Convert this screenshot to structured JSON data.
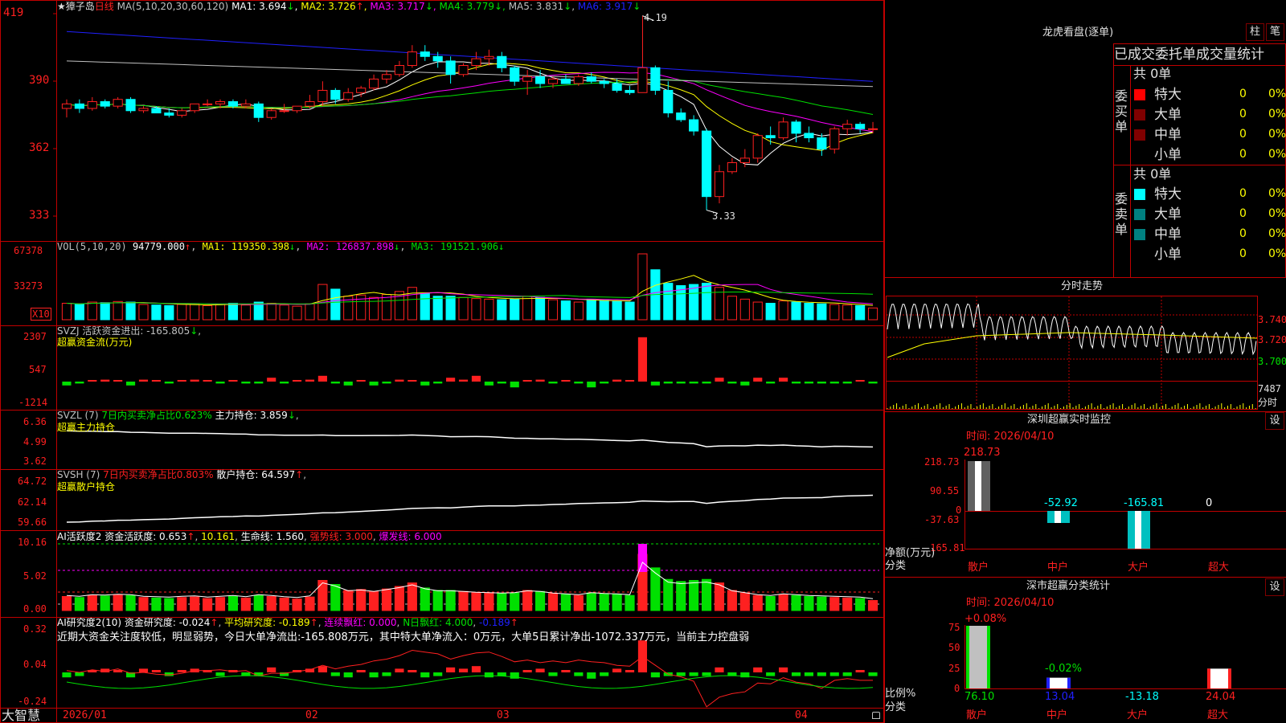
{
  "colors": {
    "up": "#ff2020",
    "down": "#00ffff",
    "green": "#00e000",
    "frame": "#c00000",
    "text": "#c0c0c0",
    "yellow": "#ffff00",
    "magenta": "#ff00ff",
    "blue": "#2020ff",
    "white": "#ffffff"
  },
  "stock": {
    "name": "★獐子岛",
    "period": "日线",
    "ma_label": "MA(5,10,20,30,60,120)",
    "ma": [
      {
        "label": "MA1:",
        "value": "3.694",
        "arrow": "↓"
      },
      {
        "label": "MA2:",
        "value": "3.726",
        "arrow": "↑"
      },
      {
        "label": "MA3:",
        "value": "3.717",
        "arrow": "↓"
      },
      {
        "label": "MA4:",
        "value": "3.779",
        "arrow": "↓"
      },
      {
        "label": "MA5:",
        "value": "3.831",
        "arrow": "↓"
      },
      {
        "label": "MA6:",
        "value": "3.917",
        "arrow": "↓"
      }
    ],
    "high_mark": "4.19",
    "low_mark": "3.33"
  },
  "price_axis": [
    "419",
    "390",
    "362",
    "333"
  ],
  "vol": {
    "header": "VOL(5,10,20)",
    "value": "94779.000",
    "arrow": "↑",
    "ma1": "MA1: 119350.398",
    "ma1_arrow": "↓",
    "ma2": "MA2: 126837.898",
    "ma2_arrow": "↓",
    "ma3": "MA3: 191521.906",
    "ma3_arrow": "↓",
    "axis": [
      "67378",
      "33273"
    ],
    "unit": "X10"
  },
  "svzj": {
    "header": "SVZJ  活跃资金进出: -165.805",
    "arrow": "↓",
    "comma": ",",
    "sub": "超赢资金流(万元)",
    "axis": [
      "2307",
      "547",
      "-1214"
    ]
  },
  "svzl": {
    "header": "SVZL (7)",
    "mid": "7日内买卖净占比0.623%",
    "tail": "主力持仓: 3.859",
    "arrow": "↓",
    "comma": ",",
    "sub": "超赢主力持仓",
    "axis": [
      "6.36",
      "4.99",
      "3.62"
    ]
  },
  "svsh": {
    "header": "SVSH (7)",
    "mid": "7日内买卖净占比0.803%",
    "tail": "散户持仓: 64.597",
    "arrow": "↑",
    "comma": ",",
    "sub": "超赢散户持仓",
    "axis": [
      "64.72",
      "62.14",
      "59.66"
    ]
  },
  "ai2": {
    "header": "AI活跃度2 资金活跃度: 0.653",
    "arrow": "↑",
    "v2": "10.161",
    "life": "生命线: 1.560",
    "strong": "强势线: 3.000",
    "burst": "爆发线: 6.000",
    "axis": [
      "10.16",
      "5.02",
      "0.00"
    ]
  },
  "ai3": {
    "header": "AI研究度2(10) 资金研究度: -0.024",
    "arrow": "↑",
    "avg": "平均研究度: -0.189",
    "avg_arrow": "↑",
    "cont": "连续飘红: 0.000",
    "nday": "N日飘红: 4.000",
    "last": "-0.189",
    "last_arrow": "↑",
    "comment": "近期大资金关注度较低，明显弱势，今日大单净流出:-165.808万元，其中特大单净流入：0万元，大单5日累计净出-1072.337万元，当前主力控盘弱",
    "axis": [
      "0.32",
      "0.04",
      "-0.24"
    ]
  },
  "xaxis": [
    "2026/01",
    "02",
    "03",
    "04"
  ],
  "footer_brand": "大智慧",
  "lhb": {
    "title": "龙虎看盘(逐单)",
    "btn1": "柱",
    "btn2": "笔",
    "subtitle": "已成交委托单成交量统计",
    "buy_total": "共 0单",
    "buy_label": "委买单",
    "buy_rows": [
      {
        "name": "特大",
        "count": "0",
        "pct": "0%"
      },
      {
        "name": "大单",
        "count": "0",
        "pct": "0%"
      },
      {
        "name": "中单",
        "count": "0",
        "pct": "0%"
      },
      {
        "name": "小单",
        "count": "0",
        "pct": "0%"
      }
    ],
    "sell_total": "共 0单",
    "sell_label": "委卖单",
    "sell_rows": [
      {
        "name": "特大",
        "count": "0",
        "pct": "0%"
      },
      {
        "name": "大单",
        "count": "0",
        "pct": "0%"
      },
      {
        "name": "中单",
        "count": "0",
        "pct": "0%"
      },
      {
        "name": "小单",
        "count": "0",
        "pct": "0%"
      }
    ]
  },
  "intraday": {
    "title": "分时走势",
    "prices": [
      "3.740",
      "3.720",
      "3.700"
    ],
    "vol": "7487",
    "vol_unit": "分时"
  },
  "monitor": {
    "title": "深圳超赢实时监控",
    "btn": "设",
    "time": "时间: 2026/04/10",
    "axis": [
      "218.73",
      "90.55",
      "0",
      "-37.63",
      "-165.81"
    ],
    "unit": "净额(万元)",
    "unit2": "分类",
    "bars": [
      {
        "cat": "散户",
        "value": 218.73,
        "label": "218.73"
      },
      {
        "cat": "中户",
        "value": -52.92,
        "label": "-52.92"
      },
      {
        "cat": "大户",
        "value": -165.81,
        "label": "-165.81"
      },
      {
        "cat": "超大",
        "value": 0,
        "label": "0"
      }
    ]
  },
  "stats": {
    "title": "深市超赢分类统计",
    "btn": "设",
    "time": "时间: 2026/04/10",
    "axis": [
      "75",
      "50",
      "25",
      "0"
    ],
    "unit": "比例%",
    "unit2": "分类",
    "bars": [
      {
        "cat": "散户",
        "value": 76.1,
        "label": "76.10",
        "chg": "+0.08%"
      },
      {
        "cat": "中户",
        "value": 13.04,
        "label": "13.04",
        "chg": "-0.02%"
      },
      {
        "cat": "大户",
        "value": -13.18,
        "label": "-13.18",
        "chg": ""
      },
      {
        "cat": "超大",
        "value": 24.04,
        "label": "24.04",
        "chg": ""
      }
    ]
  },
  "chart_data": {
    "type": "candlestick",
    "title": "★獐子岛 日线",
    "x_labels": [
      "2026/01",
      "02",
      "03",
      "04"
    ],
    "ohlc": [
      [
        3.78,
        3.82,
        3.74,
        3.8
      ],
      [
        3.8,
        3.82,
        3.76,
        3.78
      ],
      [
        3.78,
        3.83,
        3.77,
        3.81
      ],
      [
        3.81,
        3.82,
        3.78,
        3.79
      ],
      [
        3.79,
        3.83,
        3.78,
        3.82
      ],
      [
        3.82,
        3.83,
        3.76,
        3.77
      ],
      [
        3.77,
        3.79,
        3.76,
        3.78
      ],
      [
        3.78,
        3.79,
        3.76,
        3.76
      ],
      [
        3.76,
        3.78,
        3.74,
        3.75
      ],
      [
        3.75,
        3.78,
        3.74,
        3.77
      ],
      [
        3.77,
        3.8,
        3.76,
        3.8
      ],
      [
        3.8,
        3.82,
        3.79,
        3.8
      ],
      [
        3.8,
        3.82,
        3.78,
        3.81
      ],
      [
        3.81,
        3.82,
        3.78,
        3.79
      ],
      [
        3.79,
        3.82,
        3.78,
        3.8
      ],
      [
        3.8,
        3.81,
        3.72,
        3.74
      ],
      [
        3.74,
        3.78,
        3.73,
        3.77
      ],
      [
        3.77,
        3.8,
        3.76,
        3.77
      ],
      [
        3.77,
        3.79,
        3.76,
        3.79
      ],
      [
        3.79,
        3.84,
        3.78,
        3.81
      ],
      [
        3.81,
        3.9,
        3.79,
        3.86
      ],
      [
        3.86,
        3.87,
        3.8,
        3.82
      ],
      [
        3.82,
        3.87,
        3.81,
        3.85
      ],
      [
        3.85,
        3.88,
        3.83,
        3.87
      ],
      [
        3.87,
        3.93,
        3.86,
        3.91
      ],
      [
        3.91,
        3.95,
        3.89,
        3.93
      ],
      [
        3.93,
        3.99,
        3.92,
        3.97
      ],
      [
        3.97,
        4.06,
        3.96,
        4.03
      ],
      [
        4.03,
        4.06,
        3.99,
        4.01
      ],
      [
        4.01,
        4.03,
        3.96,
        3.99
      ],
      [
        3.99,
        4.01,
        3.89,
        3.93
      ],
      [
        3.93,
        3.98,
        3.92,
        3.97
      ],
      [
        3.97,
        4.03,
        3.95,
        4.0
      ],
      [
        4.0,
        4.04,
        3.97,
        4.01
      ],
      [
        4.01,
        4.03,
        3.94,
        3.96
      ],
      [
        3.96,
        3.97,
        3.88,
        3.9
      ],
      [
        3.9,
        3.95,
        3.84,
        3.92
      ],
      [
        3.92,
        3.95,
        3.87,
        3.89
      ],
      [
        3.89,
        3.92,
        3.87,
        3.91
      ],
      [
        3.91,
        3.93,
        3.89,
        3.89
      ],
      [
        3.89,
        3.93,
        3.88,
        3.92
      ],
      [
        3.92,
        3.94,
        3.89,
        3.9
      ],
      [
        3.9,
        3.91,
        3.87,
        3.89
      ],
      [
        3.89,
        3.91,
        3.85,
        3.86
      ],
      [
        3.86,
        3.88,
        3.84,
        3.85
      ],
      [
        3.85,
        4.19,
        3.85,
        3.96
      ],
      [
        3.96,
        3.97,
        3.84,
        3.86
      ],
      [
        3.86,
        3.9,
        3.74,
        3.76
      ],
      [
        3.76,
        3.78,
        3.72,
        3.73
      ],
      [
        3.73,
        3.75,
        3.66,
        3.68
      ],
      [
        3.68,
        3.69,
        3.33,
        3.39
      ],
      [
        3.39,
        3.53,
        3.36,
        3.5
      ],
      [
        3.5,
        3.56,
        3.49,
        3.54
      ],
      [
        3.54,
        3.6,
        3.52,
        3.56
      ],
      [
        3.56,
        3.67,
        3.54,
        3.66
      ],
      [
        3.66,
        3.7,
        3.62,
        3.65
      ],
      [
        3.65,
        3.74,
        3.64,
        3.72
      ],
      [
        3.72,
        3.73,
        3.63,
        3.67
      ],
      [
        3.67,
        3.7,
        3.63,
        3.65
      ],
      [
        3.65,
        3.67,
        3.57,
        3.6
      ],
      [
        3.6,
        3.7,
        3.58,
        3.69
      ],
      [
        3.69,
        3.73,
        3.66,
        3.71
      ],
      [
        3.71,
        3.72,
        3.67,
        3.69
      ],
      [
        3.69,
        3.72,
        3.67,
        3.69
      ]
    ],
    "volume": [
      28,
      26,
      30,
      29,
      31,
      30,
      26,
      25,
      24,
      26,
      27,
      24,
      26,
      28,
      25,
      30,
      28,
      25,
      23,
      27,
      60,
      52,
      40,
      42,
      38,
      43,
      48,
      55,
      45,
      40,
      40,
      38,
      36,
      35,
      34,
      35,
      40,
      38,
      34,
      32,
      30,
      35,
      33,
      32,
      30,
      112,
      85,
      62,
      58,
      60,
      62,
      55,
      40,
      35,
      30,
      28,
      32,
      30,
      28,
      27,
      26,
      25,
      24,
      20
    ],
    "flow": [
      -2,
      -1,
      0,
      1,
      0,
      -2,
      1,
      0,
      -1,
      0,
      1,
      0,
      -1,
      0,
      -1,
      -1,
      2,
      -1,
      0,
      1,
      3,
      -1,
      -2,
      0,
      -2,
      -1,
      1,
      0,
      -2,
      -1,
      2,
      1,
      3,
      -2,
      -1,
      -3,
      0,
      1,
      -1,
      0,
      -1,
      -3,
      -1,
      1,
      0,
      23,
      -2,
      -1,
      -1,
      -1,
      -1,
      2,
      -1,
      -2,
      2,
      -1,
      2,
      -1,
      -1,
      -1,
      -1,
      -1,
      0,
      -1
    ],
    "ylim": [
      3.3,
      4.21
    ],
    "ma_series": [
      "MA1",
      "MA2",
      "MA3",
      "MA4",
      "MA5",
      "MA6"
    ]
  }
}
